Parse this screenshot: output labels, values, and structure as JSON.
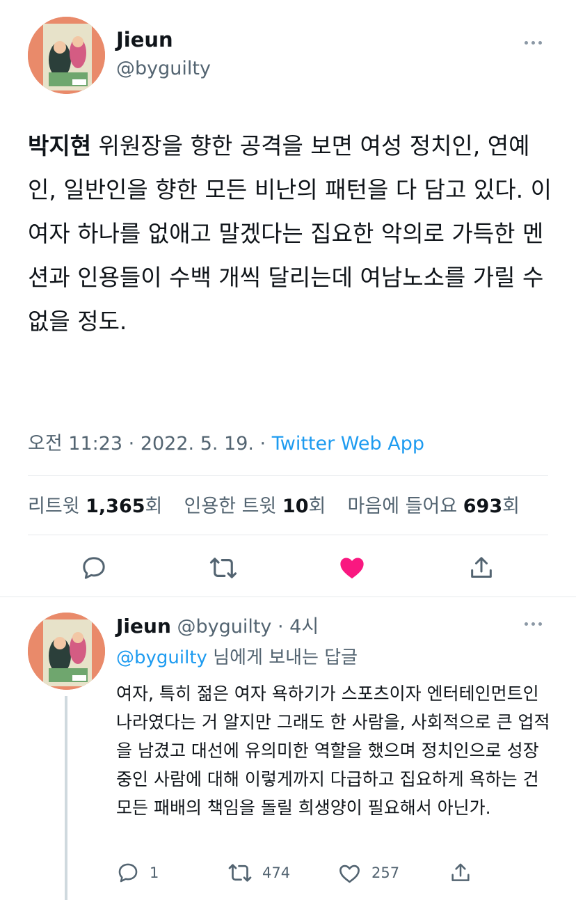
{
  "tweet": {
    "author_name": "Jieun",
    "author_handle": "@byguilty",
    "text_bold": "박지현",
    "text_rest": " 위원장을 향한 공격을 보면 여성 정치인, 연예인, 일반인을 향한 모든 비난의 패턴을 다 담고 있다. 이 여자 하나를 없애고 말겠다는 집요한 악의로 가득한 멘션과 인용들이 수백 개씩 달리는데 여남노소를 가릴 수 없을 정도.",
    "timestamp": "오전 11:23 · 2022. 5. 19. · ",
    "source": "Twitter Web App",
    "stats": {
      "retweets_label": "리트윗 ",
      "retweets_count": "1,365",
      "retweets_unit": "회",
      "quotes_label": "인용한 트윗 ",
      "quotes_count": "10",
      "quotes_unit": "회",
      "likes_label": "마음에 들어요 ",
      "likes_count": "693",
      "likes_unit": "회"
    },
    "liked": true,
    "colors": {
      "like": "#f91880",
      "link": "#1d9bf0",
      "muted": "#536471"
    }
  },
  "reply": {
    "author_name": "Jieun",
    "author_handle": "@byguilty",
    "time": " · 4시",
    "replying_to_handle": "@byguilty",
    "replying_to_suffix": " 님에게 보내는 답글",
    "text": "여자, 특히 젊은 여자 욕하기가 스포츠이자 엔터테인먼트인 나라였다는 거 알지만 그래도 한 사람을, 사회적으로 큰 업적을 남겼고 대선에 유의미한 역할을 했으며 정치인으로 성장 중인 사람에 대해 이렇게까지 다급하고 집요하게 욕하는 건 모든 패배의 책임을 돌릴 희생양이 필요해서 아닌가.",
    "reply_count": "1",
    "retweet_count": "474",
    "like_count": "257"
  },
  "icons": [
    "more-icon",
    "reply-icon",
    "retweet-icon",
    "like-icon",
    "share-icon"
  ]
}
